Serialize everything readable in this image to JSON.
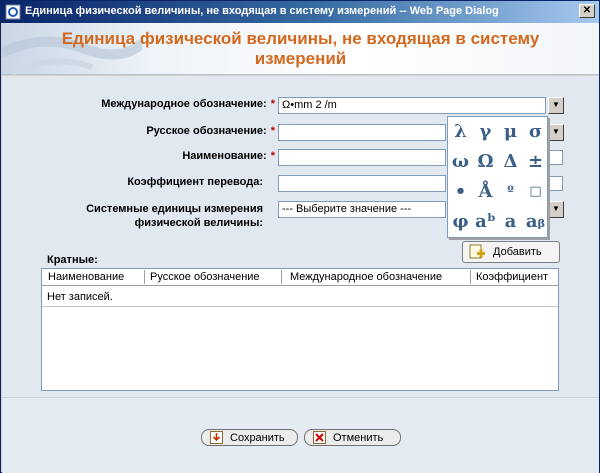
{
  "window": {
    "title": "Единица физической величины, не входящая в систему измерений -- Web Page Dialog",
    "close_glyph": "✕"
  },
  "header": {
    "line1": "Единица физической величины, не входящая в систему",
    "line2": "измерений"
  },
  "form": {
    "international": {
      "label": "Международное обозначение:",
      "required": "*",
      "value": "Ω•mm 2 /m"
    },
    "russian": {
      "label": "Русское обозначение:",
      "required": "*",
      "value": ""
    },
    "name": {
      "label": "Наименование:",
      "required": "*",
      "value": ""
    },
    "coefficient": {
      "label": "Коэффициент перевода:",
      "value": ""
    },
    "system_units": {
      "label_line1": "Системные единицы измерения",
      "label_line2": "физической величины:",
      "value": "--- Выберите значение ---"
    }
  },
  "symbols": [
    "λ",
    "γ",
    "μ",
    "σ",
    "ω",
    "Ω",
    "Δ",
    "±",
    "•",
    "Å",
    "º",
    "□",
    "φ",
    "aᵇ",
    "a",
    "aᵦ"
  ],
  "add_button": "Добавить",
  "multiples": {
    "label": "Кратные:",
    "columns": [
      "Наименование",
      "Русское обозначение",
      "Международное обозначение",
      "Коэффициент"
    ],
    "empty_text": "Нет записей."
  },
  "footer": {
    "save": "Сохранить",
    "cancel": "Отменить"
  },
  "colors": {
    "heading": "#d2691e",
    "required": "#c00000",
    "titlebar": "#0a246a",
    "symbols": "#3b5f86"
  }
}
